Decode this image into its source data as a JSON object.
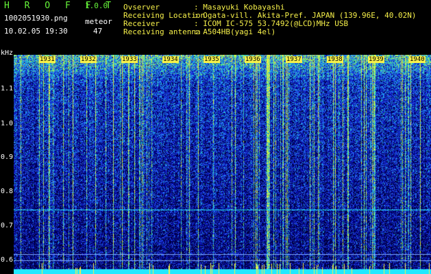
{
  "header": {
    "app_title": "H R O F F T",
    "app_version": "1.0.0",
    "file_name": "1002051930.png",
    "capture_time": "10.02.05 19:30",
    "meteor_label": "meteor",
    "meteor_count": "47"
  },
  "info": {
    "observer_label": "Ovserver",
    "observer_value": ": Masayuki Kobayashi",
    "location_label": "Receiving Location",
    "location_value": ": Ogata-vill. Akita-Pref. JAPAN (139.96E, 40.02N)",
    "receiver_label": "Receiver",
    "receiver_value": ": ICOM IC-575 53.7492(@LCD)MHz USB",
    "antenna_label": "Receiving antenna",
    "antenna_value": ": A504HB(yagi 4el)"
  },
  "axis": {
    "unit": "kHz",
    "y_ticks": [
      "1.1",
      "1.0",
      "0.9",
      "0.8",
      "0.7",
      "0.6"
    ],
    "time_labels": [
      "1931",
      "1932",
      "1933",
      "1934",
      "1935",
      "1936",
      "1937",
      "1938",
      "1939",
      "1940"
    ]
  },
  "colors": {
    "text_green": "#66f53a",
    "text_yellow": "#f7f14a",
    "text_white": "#ffffff",
    "background": "#000000",
    "noise_floor": "#1f2fc8",
    "signal_high": "#9de94a",
    "baseline": "#22e8ff"
  }
}
